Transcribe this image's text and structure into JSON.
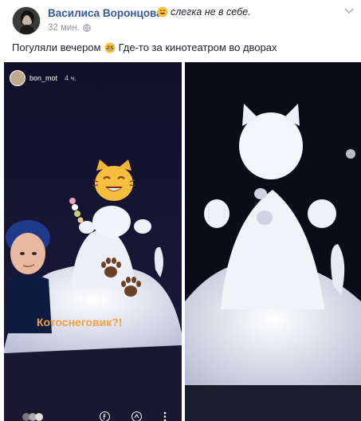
{
  "post": {
    "author": "Василиса Воронцова",
    "feeling": "слегка не в себе.",
    "time": "32 мин.",
    "status_text_1": "Погуляли вечером",
    "status_text_2": "Где-то за кинотеатром во дворах"
  },
  "story": {
    "username": "bon_mot",
    "time": "4 ч.",
    "caption": "Котоснеговик?!"
  },
  "colors": {
    "link": "#365899",
    "meta": "#90949c",
    "caption": "#f0a040"
  },
  "icons": [
    "smiling-sweat-emoji-icon",
    "grinning-sweat-emoji-icon",
    "cat-face-emoji-icon",
    "paw-print-icon",
    "globe-icon",
    "chevron-down-icon",
    "share-icon"
  ]
}
